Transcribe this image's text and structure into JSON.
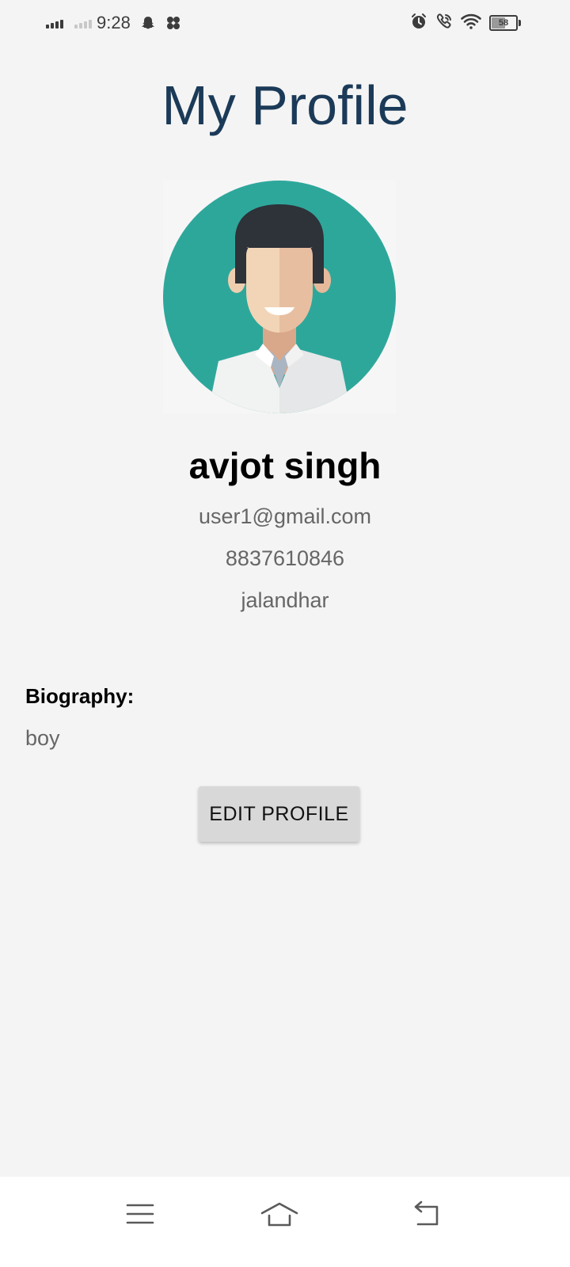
{
  "status_bar": {
    "time": "9:28",
    "battery": "58",
    "battery_level": 0.58
  },
  "icons": {
    "signal_1": "signal-bars-icon",
    "signal_2": "signal-bars-dim-icon",
    "snapchat": "snapchat-ghost-icon",
    "fan": "fan-icon",
    "alarm": "alarm-clock-icon",
    "wifi_call": "wifi-calling-icon",
    "wifi": "wifi-icon",
    "battery": "battery-icon",
    "nav_menu": "menu-icon",
    "nav_home": "home-icon",
    "nav_back": "back-icon"
  },
  "profile": {
    "title": "My Profile",
    "name": "avjot singh",
    "email": "user1@gmail.com",
    "phone": "8837610846",
    "city": "jalandhar",
    "bio_label": "Biography:",
    "bio": "boy",
    "edit_button": "EDIT PROFILE"
  },
  "colors": {
    "title": "#1b3a58",
    "background": "#f4f4f4",
    "avatar_circle": "#2ea79b",
    "button": "#d7d8d7"
  }
}
